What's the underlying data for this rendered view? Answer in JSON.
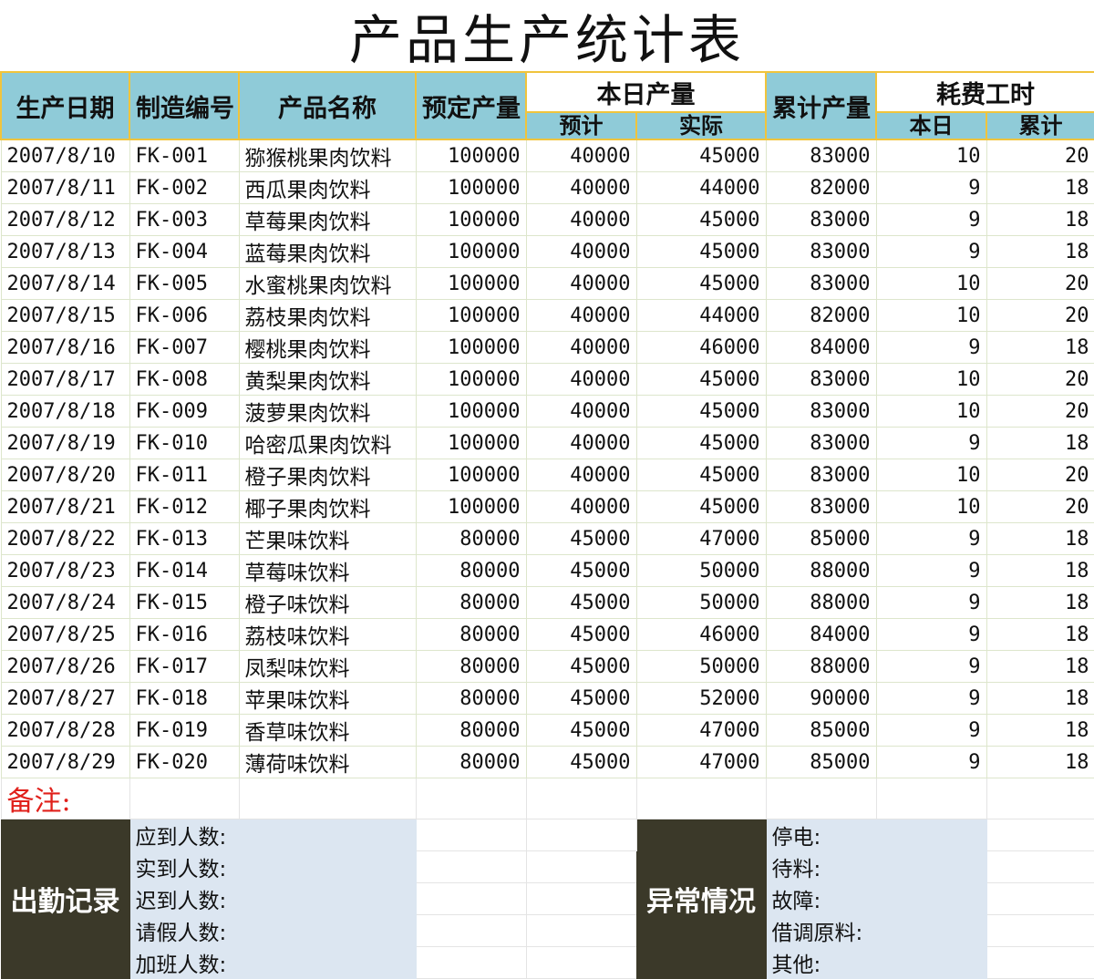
{
  "title": "产品生产统计表",
  "headers": {
    "date": "生产日期",
    "code": "制造编号",
    "name": "产品名称",
    "planned": "预定产量",
    "today": "本日产量",
    "today_plan": "预计",
    "today_actual": "实际",
    "cumulative": "累计产量",
    "hours": "耗费工时",
    "hours_today": "本日",
    "hours_total": "累计"
  },
  "rows": [
    {
      "date": "2007/8/10",
      "code": "FK-001",
      "name": "猕猴桃果肉饮料",
      "planned": "100000",
      "plan": "40000",
      "actual": "45000",
      "cum": "83000",
      "h1": "10",
      "h2": "20"
    },
    {
      "date": "2007/8/11",
      "code": "FK-002",
      "name": "西瓜果肉饮料",
      "planned": "100000",
      "plan": "40000",
      "actual": "44000",
      "cum": "82000",
      "h1": "9",
      "h2": "18"
    },
    {
      "date": "2007/8/12",
      "code": "FK-003",
      "name": "草莓果肉饮料",
      "planned": "100000",
      "plan": "40000",
      "actual": "45000",
      "cum": "83000",
      "h1": "9",
      "h2": "18"
    },
    {
      "date": "2007/8/13",
      "code": "FK-004",
      "name": "蓝莓果肉饮料",
      "planned": "100000",
      "plan": "40000",
      "actual": "45000",
      "cum": "83000",
      "h1": "9",
      "h2": "18"
    },
    {
      "date": "2007/8/14",
      "code": "FK-005",
      "name": "水蜜桃果肉饮料",
      "planned": "100000",
      "plan": "40000",
      "actual": "45000",
      "cum": "83000",
      "h1": "10",
      "h2": "20"
    },
    {
      "date": "2007/8/15",
      "code": "FK-006",
      "name": "荔枝果肉饮料",
      "planned": "100000",
      "plan": "40000",
      "actual": "44000",
      "cum": "82000",
      "h1": "10",
      "h2": "20"
    },
    {
      "date": "2007/8/16",
      "code": "FK-007",
      "name": "樱桃果肉饮料",
      "planned": "100000",
      "plan": "40000",
      "actual": "46000",
      "cum": "84000",
      "h1": "9",
      "h2": "18"
    },
    {
      "date": "2007/8/17",
      "code": "FK-008",
      "name": "黄梨果肉饮料",
      "planned": "100000",
      "plan": "40000",
      "actual": "45000",
      "cum": "83000",
      "h1": "10",
      "h2": "20"
    },
    {
      "date": "2007/8/18",
      "code": "FK-009",
      "name": "菠萝果肉饮料",
      "planned": "100000",
      "plan": "40000",
      "actual": "45000",
      "cum": "83000",
      "h1": "10",
      "h2": "20"
    },
    {
      "date": "2007/8/19",
      "code": "FK-010",
      "name": "哈密瓜果肉饮料",
      "planned": "100000",
      "plan": "40000",
      "actual": "45000",
      "cum": "83000",
      "h1": "9",
      "h2": "18"
    },
    {
      "date": "2007/8/20",
      "code": "FK-011",
      "name": "橙子果肉饮料",
      "planned": "100000",
      "plan": "40000",
      "actual": "45000",
      "cum": "83000",
      "h1": "10",
      "h2": "20"
    },
    {
      "date": "2007/8/21",
      "code": "FK-012",
      "name": "椰子果肉饮料",
      "planned": "100000",
      "plan": "40000",
      "actual": "45000",
      "cum": "83000",
      "h1": "10",
      "h2": "20"
    },
    {
      "date": "2007/8/22",
      "code": "FK-013",
      "name": "芒果味饮料",
      "planned": "80000",
      "plan": "45000",
      "actual": "47000",
      "cum": "85000",
      "h1": "9",
      "h2": "18"
    },
    {
      "date": "2007/8/23",
      "code": "FK-014",
      "name": "草莓味饮料",
      "planned": "80000",
      "plan": "45000",
      "actual": "50000",
      "cum": "88000",
      "h1": "9",
      "h2": "18"
    },
    {
      "date": "2007/8/24",
      "code": "FK-015",
      "name": "橙子味饮料",
      "planned": "80000",
      "plan": "45000",
      "actual": "50000",
      "cum": "88000",
      "h1": "9",
      "h2": "18"
    },
    {
      "date": "2007/8/25",
      "code": "FK-016",
      "name": "荔枝味饮料",
      "planned": "80000",
      "plan": "45000",
      "actual": "46000",
      "cum": "84000",
      "h1": "9",
      "h2": "18"
    },
    {
      "date": "2007/8/26",
      "code": "FK-017",
      "name": "凤梨味饮料",
      "planned": "80000",
      "plan": "45000",
      "actual": "50000",
      "cum": "88000",
      "h1": "9",
      "h2": "18"
    },
    {
      "date": "2007/8/27",
      "code": "FK-018",
      "name": "苹果味饮料",
      "planned": "80000",
      "plan": "45000",
      "actual": "52000",
      "cum": "90000",
      "h1": "9",
      "h2": "18"
    },
    {
      "date": "2007/8/28",
      "code": "FK-019",
      "name": "香草味饮料",
      "planned": "80000",
      "plan": "45000",
      "actual": "47000",
      "cum": "85000",
      "h1": "9",
      "h2": "18"
    },
    {
      "date": "2007/8/29",
      "code": "FK-020",
      "name": "薄荷味饮料",
      "planned": "80000",
      "plan": "45000",
      "actual": "47000",
      "cum": "85000",
      "h1": "9",
      "h2": "18"
    }
  ],
  "remark": "备注:",
  "attendance": {
    "title": "出勤记录",
    "items": [
      "应到人数:",
      "实到人数:",
      "迟到人数:",
      "请假人数:",
      "加班人数:"
    ]
  },
  "anomaly": {
    "title": "异常情况",
    "items": [
      "停电:",
      "待料:",
      "故障:",
      "借调原料:",
      "其他:"
    ]
  }
}
